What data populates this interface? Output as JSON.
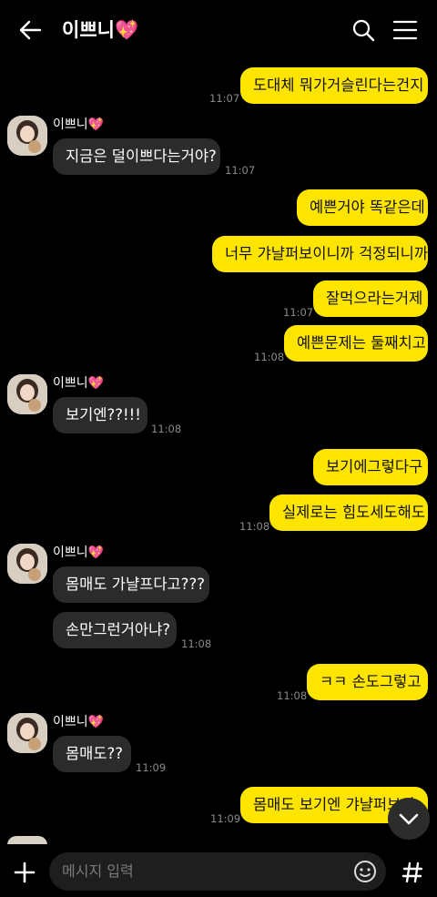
{
  "header": {
    "title": "이쁘니",
    "title_emoji": "💖"
  },
  "contact": {
    "name": "이쁘니",
    "name_emoji": "💖"
  },
  "messages": [
    {
      "text": "도대체 뭐가거슬린다는건지",
      "time": "11:07"
    },
    {
      "text": "지금은 덜이쁘다는거야?",
      "time": "11:07"
    },
    {
      "text": "예쁜거야 똑같은데"
    },
    {
      "text": "너무 갸냘퍼보이니까 걱정되니까"
    },
    {
      "text": "잘먹으라는거제",
      "time": "11:07"
    },
    {
      "text": "예쁜문제는 둘째치고",
      "time": "11:08"
    },
    {
      "text": "보기엔??!!!",
      "time": "11:08"
    },
    {
      "text": "보기에그렇다구"
    },
    {
      "text": "실제로는 힘도세도해도",
      "time": "11:08"
    },
    {
      "text": "몸매도 가냘프다고???"
    },
    {
      "text": "손만그런거아냐?",
      "time": "11:08"
    },
    {
      "text": "ㅋㅋ 손도그렇고",
      "time": "11:08"
    },
    {
      "text": "몸매도??",
      "time": "11:09"
    },
    {
      "text": "몸매도 보기엔 갸냘퍼보이",
      "time": "11:09"
    }
  ],
  "input": {
    "placeholder": "메시지 입력"
  },
  "colors": {
    "my_bubble": "#fee500",
    "their_bubble": "#2b2b2b",
    "background": "#000000"
  }
}
